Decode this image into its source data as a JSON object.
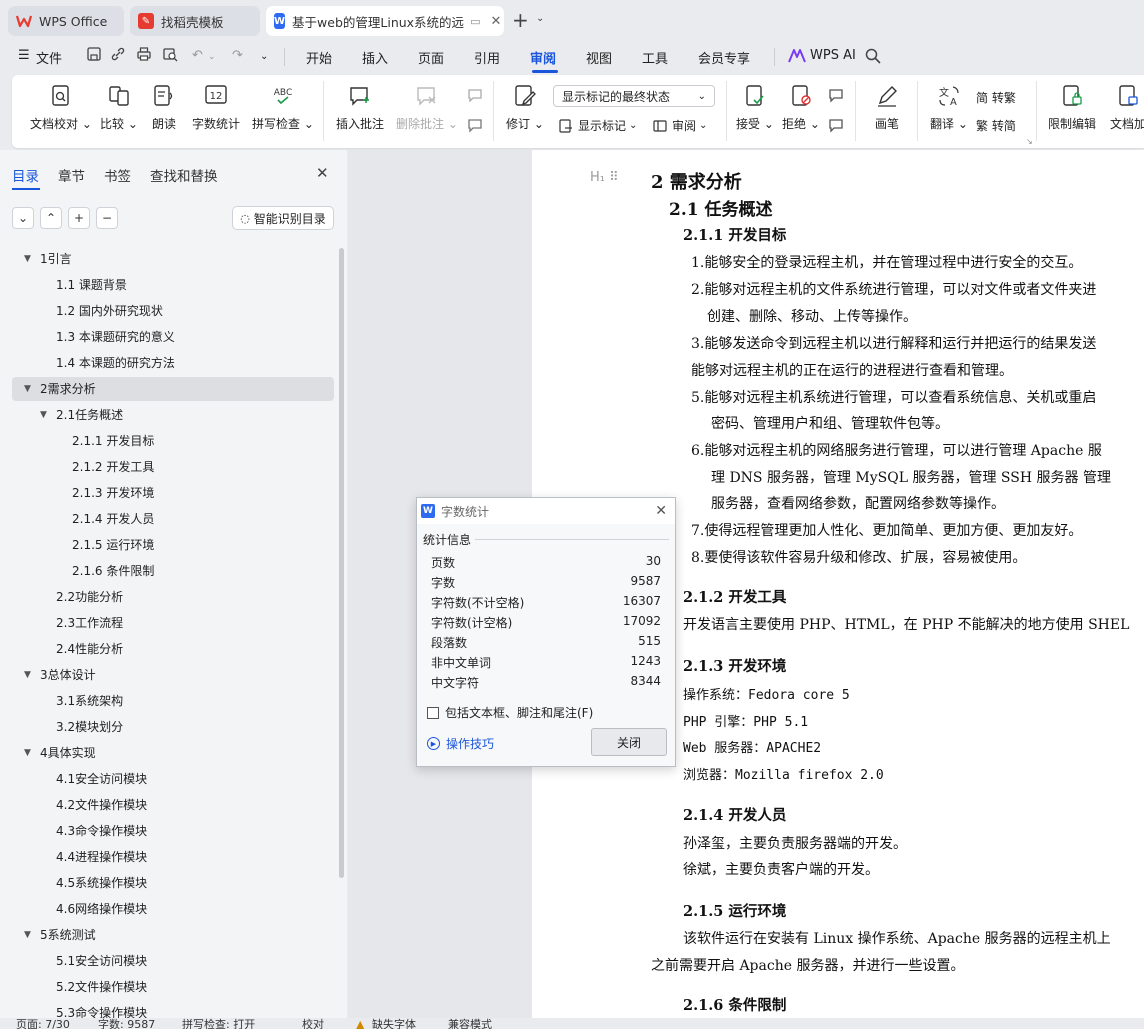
{
  "tabs": [
    {
      "label": "WPS Office"
    },
    {
      "label": "找稻壳模板"
    },
    {
      "label": "基于web的管理Linux系统的远"
    }
  ],
  "menu": {
    "file": "文件",
    "items": [
      "开始",
      "插入",
      "页面",
      "引用",
      "审阅",
      "视图",
      "工具",
      "会员专享"
    ],
    "active": "审阅",
    "wps_ai": "WPS AI"
  },
  "ribbon": {
    "doc_check": "文档校对",
    "compare": "比较",
    "read_aloud": "朗读",
    "word_count": "字数统计",
    "spell_check": "拼写检查",
    "insert_comment": "插入批注",
    "delete_comment": "删除批注",
    "revise": "修订",
    "markup_select": "显示标记的最终状态",
    "show_markup": "显示标记",
    "review": "审阅",
    "accept": "接受",
    "reject": "拒绝",
    "pen": "画笔",
    "translate": "翻译",
    "to_traditional": "简 转繁",
    "to_simplified": "繁 转简",
    "restrict_edit": "限制编辑",
    "doc_encrypt": "文档加"
  },
  "panel": {
    "tabs": [
      "目录",
      "章节",
      "书签",
      "查找和替换"
    ],
    "smart_toc": "智能识别目录",
    "toc": [
      {
        "label": "1引言",
        "level": 1,
        "arrow": "▼"
      },
      {
        "label": "1.1  课题背景",
        "level": 2
      },
      {
        "label": "1.2  国内外研究现状",
        "level": 2
      },
      {
        "label": "1.3  本课题研究的意义",
        "level": 2
      },
      {
        "label": "1.4  本课题的研究方法",
        "level": 2
      },
      {
        "label": "2需求分析",
        "level": 1,
        "arrow": "▼"
      },
      {
        "label": "2.1任务概述",
        "level": 2,
        "arrow": "▼"
      },
      {
        "label": "2.1.1  开发目标",
        "level": 3
      },
      {
        "label": "2.1.2  开发工具",
        "level": 3
      },
      {
        "label": "2.1.3  开发环境",
        "level": 3
      },
      {
        "label": "2.1.4  开发人员",
        "level": 3
      },
      {
        "label": "2.1.5  运行环境",
        "level": 3
      },
      {
        "label": "2.1.6  条件限制",
        "level": 3
      },
      {
        "label": "2.2功能分析",
        "level": 2
      },
      {
        "label": "2.3工作流程",
        "level": 2
      },
      {
        "label": "2.4性能分析",
        "level": 2
      },
      {
        "label": "3总体设计",
        "level": 1,
        "arrow": "▼"
      },
      {
        "label": "3.1系统架构",
        "level": 2
      },
      {
        "label": "3.2模块划分",
        "level": 2
      },
      {
        "label": "4具体实现",
        "level": 1,
        "arrow": "▼"
      },
      {
        "label": "4.1安全访问模块",
        "level": 2
      },
      {
        "label": "4.2文件操作模块",
        "level": 2
      },
      {
        "label": "4.3命令操作模块",
        "level": 2
      },
      {
        "label": "4.4进程操作模块",
        "level": 2
      },
      {
        "label": "4.5系统操作模块",
        "level": 2
      },
      {
        "label": "4.6网络操作模块",
        "level": 2
      },
      {
        "label": "5系统测试",
        "level": 1,
        "arrow": "▼"
      },
      {
        "label": "5.1安全访问模块",
        "level": 2
      },
      {
        "label": "5.2文件操作模块",
        "level": 2
      },
      {
        "label": "5.3命令操作模块",
        "level": 2
      }
    ]
  },
  "document": {
    "lines": [
      {
        "text": "2   需求分析",
        "cls": "h1"
      },
      {
        "text": "2.1  任务概述",
        "cls": "h2"
      },
      {
        "text": "2.1.1   开发目标",
        "cls": "h3"
      },
      {
        "text": "1.能够安全的登录远程主机，并在管理过程中进行安全的交互。"
      },
      {
        "text": "2.能够对远程主机的文件系统进行管理，可以对文件或者文件夹进"
      },
      {
        "text": "创建、删除、移动、上传等操作。"
      },
      {
        "text": "3.能够发送命令到远程主机以进行解释和运行并把运行的结果发送"
      },
      {
        "text": "能够对远程主机的正在运行的进程进行查看和管理。"
      },
      {
        "text": "5.能够对远程主机系统进行管理，可以查看系统信息、关机或重启"
      },
      {
        "text": "密码、管理用户和组、管理软件包等。"
      },
      {
        "text": "6.能够对远程主机的网络服务进行管理，可以进行管理 Apache 服"
      },
      {
        "text": "理 DNS 服务器，管理 MySQL 服务器，管理 SSH 服务器 管理"
      },
      {
        "text": "服务器，查看网络参数，配置网络参数等操作。"
      },
      {
        "text": "7.使得远程管理更加人性化、更加简单、更加方便、更加友好。"
      },
      {
        "text": "8.要使得该软件容易升级和修改、扩展，容易被使用。"
      },
      {
        "text": "2.1.2 开发工具",
        "cls": "h3"
      },
      {
        "text": "开发语言主要使用 PHP、HTML，在 PHP 不能解决的地方使用 SHEL"
      },
      {
        "text": "2.1.3 开发环境",
        "cls": "h3"
      },
      {
        "text": "操作系统：Fedora core 5",
        "cls": "mono"
      },
      {
        "text": "PHP 引擎：PHP 5.1",
        "cls": "mono"
      },
      {
        "text": "Web 服务器：APACHE2",
        "cls": "mono"
      },
      {
        "text": "浏览器：Mozilla firefox 2.0",
        "cls": "mono"
      },
      {
        "text": "2.1.4 开发人员",
        "cls": "h3"
      },
      {
        "text": "孙泽玺，主要负责服务器端的开发。"
      },
      {
        "text": "徐斌，主要负责客户端的开发。"
      },
      {
        "text": "2.1.5 运行环境",
        "cls": "h3"
      },
      {
        "text": "该软件运行在安装有 Linux 操作系统、Apache 服务器的远程主机上"
      },
      {
        "text": "之前需要开启 Apache 服务器，并进行一些设置。"
      },
      {
        "text": "2.1.6 条件限制",
        "cls": "h3"
      }
    ]
  },
  "dialog": {
    "title": "字数统计",
    "section": "统计信息",
    "rows": [
      {
        "label": "页数",
        "value": "30"
      },
      {
        "label": "字数",
        "value": "9587"
      },
      {
        "label": "字符数(不计空格)",
        "value": "16307"
      },
      {
        "label": "字符数(计空格)",
        "value": "17092"
      },
      {
        "label": "段落数",
        "value": "515"
      },
      {
        "label": "非中文单词",
        "value": "1243"
      },
      {
        "label": "中文字符",
        "value": "8344"
      }
    ],
    "checkbox": "包括文本框、脚注和尾注(F)",
    "tips": "操作技巧",
    "close": "关闭"
  },
  "status": {
    "page": "页面: 7/30",
    "words": "字数: 9587",
    "spell": "拼写检查: 打开",
    "proof": "校对",
    "missing_font": "缺失字体",
    "compat": "兼容模式"
  },
  "colors": {
    "accent": "#1a56db",
    "wps_red": "#e63b30",
    "doc_blue": "#2f6bf0"
  }
}
